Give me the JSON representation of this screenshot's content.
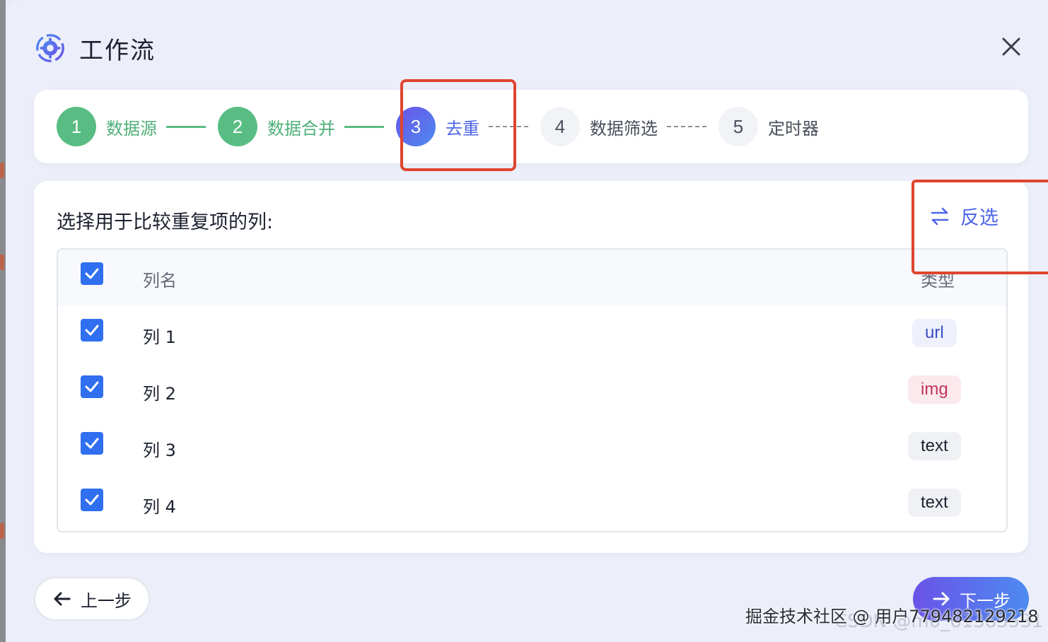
{
  "dialog": {
    "title": "工作流",
    "title_icon": "gear-flow-icon",
    "close_icon": "close-icon"
  },
  "steps": [
    {
      "number": "1",
      "label": "数据源",
      "status": "done"
    },
    {
      "number": "2",
      "label": "数据合并",
      "status": "done"
    },
    {
      "number": "3",
      "label": "去重",
      "status": "active"
    },
    {
      "number": "4",
      "label": "数据筛选",
      "status": "todo"
    },
    {
      "number": "5",
      "label": "定时器",
      "status": "todo"
    }
  ],
  "dedupe": {
    "prompt": "选择用于比较重复项的列:",
    "invert_label": "反选",
    "invert_icon": "swap-arrows-icon",
    "header": {
      "name": "列名",
      "type": "类型",
      "checked": true
    },
    "rows": [
      {
        "name": "列 1",
        "type": "url",
        "checked": true
      },
      {
        "name": "列 2",
        "type": "img",
        "checked": true
      },
      {
        "name": "列 3",
        "type": "text",
        "checked": true
      },
      {
        "name": "列 4",
        "type": "text",
        "checked": true
      }
    ]
  },
  "footer": {
    "prev_label": "上一步",
    "next_label": "下一步"
  },
  "watermark": {
    "primary": "掘金技术社区 @ 用户779482129218",
    "secondary": "CSDN @m0_61385531"
  },
  "colors": {
    "done": "#59bd83",
    "active": "#4e66e6",
    "checkbox": "#2f6ff0",
    "highlight_box": "#e0442e",
    "badge_url_bg": "#eef0fb",
    "badge_url_fg": "#3b4fc4",
    "badge_img_bg": "#fbe9ee",
    "badge_img_fg": "#c2335e",
    "badge_text_bg": "#f0f1f4",
    "badge_text_fg": "#1d2130"
  }
}
